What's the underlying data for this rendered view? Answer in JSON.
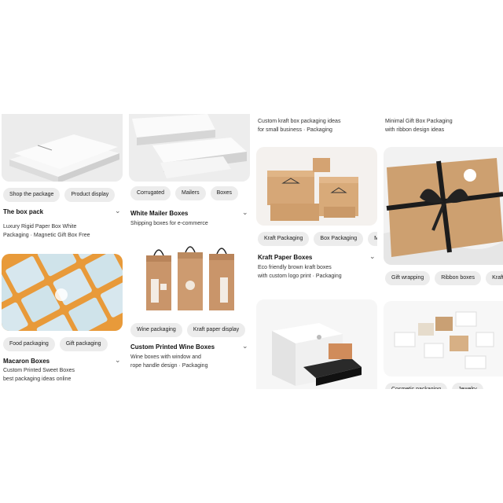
{
  "col1": {
    "card1": {
      "chips": [
        "Shop the package",
        "Product display"
      ],
      "title": "The box pack",
      "desc1": "Luxury Rigid Paper Box White",
      "desc2": "Packaging · Magnetic Gift Box Free"
    },
    "card2": {
      "chips": [
        "Food packaging",
        "Gift packaging"
      ],
      "title": "Macaron Boxes",
      "desc1": "Custom Printed Sweet Boxes",
      "desc2": "best packaging ideas online"
    }
  },
  "col2": {
    "card1": {
      "chips": [
        "Corrugated",
        "Mailers",
        "Boxes"
      ],
      "title": "White Mailer Boxes",
      "desc1": "Shipping boxes for e-commerce"
    },
    "card2": {
      "chips": [
        "Wine packaging",
        "Kraft paper display"
      ],
      "title": "Custom Printed Wine Boxes",
      "desc1": "Wine boxes with window and",
      "desc2": "rope handle design · Packaging"
    }
  },
  "col3": {
    "top1": "Custom kraft box packaging ideas",
    "top2": "for small business · Packaging",
    "card1": {
      "chips": [
        "Kraft Packaging",
        "Box Packaging",
        "Mailer"
      ],
      "title": "Kraft Paper Boxes",
      "desc1": "Eco friendly brown kraft boxes",
      "desc2": "with custom logo print · Packaging"
    },
    "card2": {}
  },
  "col4": {
    "top1": "Minimal Gift Box Packaging",
    "top2": "with ribbon design ideas",
    "card1": {
      "chips": [
        "Gift wrapping",
        "Ribbon boxes",
        "Kraft"
      ]
    },
    "card2": {
      "chips": [
        "Cosmetic packaging",
        "Jewelry"
      ]
    }
  }
}
